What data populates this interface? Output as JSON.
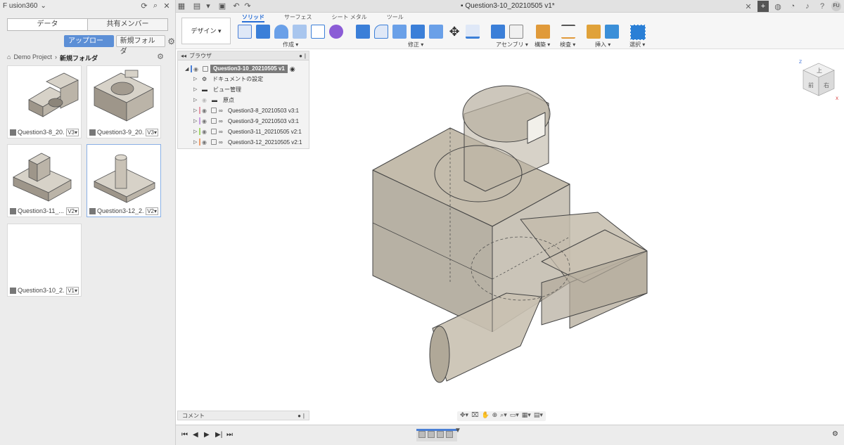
{
  "left_panel": {
    "app_title": "F usion360",
    "tabs": [
      "データ",
      "共有メンバー"
    ],
    "upload_label": "アップロード",
    "new_folder_label": "新規フォルダ",
    "breadcrumb": {
      "project": "Demo Project",
      "folder": "新規フォルダ"
    },
    "files": [
      {
        "name": "Question3-8_20...",
        "version": "V3▾"
      },
      {
        "name": "Question3-9_20...",
        "version": "V3▾"
      },
      {
        "name": "Question3-11_...",
        "version": "V2▾"
      },
      {
        "name": "Question3-12_2...",
        "version": "V2▾"
      },
      {
        "name": "Question3-10_2...",
        "version": "V1▾"
      }
    ]
  },
  "tabbar": {
    "doc_title": "Question3-10_20210505 v1*",
    "avatar": "FU"
  },
  "toolbar": {
    "workspace": "デザイン ▾",
    "tabs": [
      "ソリッド",
      "サーフェス",
      "シート メタル",
      "ツール"
    ],
    "groups": [
      "作成 ▾",
      "修正 ▾",
      "アセンブリ ▾",
      "構築 ▾",
      "検査 ▾",
      "挿入 ▾",
      "選択 ▾"
    ]
  },
  "browser": {
    "title": "ブラウザ",
    "root": "Question3-10_20210505 v1",
    "items": [
      {
        "label": "ドキュメントの設定",
        "kind": "gear"
      },
      {
        "label": "ビュー管理",
        "kind": "folder"
      },
      {
        "label": "原点",
        "kind": "folder"
      },
      {
        "label": "Question3-8_20210503 v3:1",
        "kind": "link",
        "color": "#e59aa8"
      },
      {
        "label": "Question3-9_20210503 v3:1",
        "kind": "link",
        "color": "#c7a0e0"
      },
      {
        "label": "Question3-11_20210505 v2:1",
        "kind": "link",
        "color": "#a6d86e"
      },
      {
        "label": "Question3-12_20210505 v2:1",
        "kind": "link",
        "color": "#f0a070"
      }
    ]
  },
  "comments": {
    "label": "コメント"
  },
  "viewcube": {
    "top": "上",
    "front": "前",
    "right": "右",
    "z": "Z",
    "x": "X"
  }
}
